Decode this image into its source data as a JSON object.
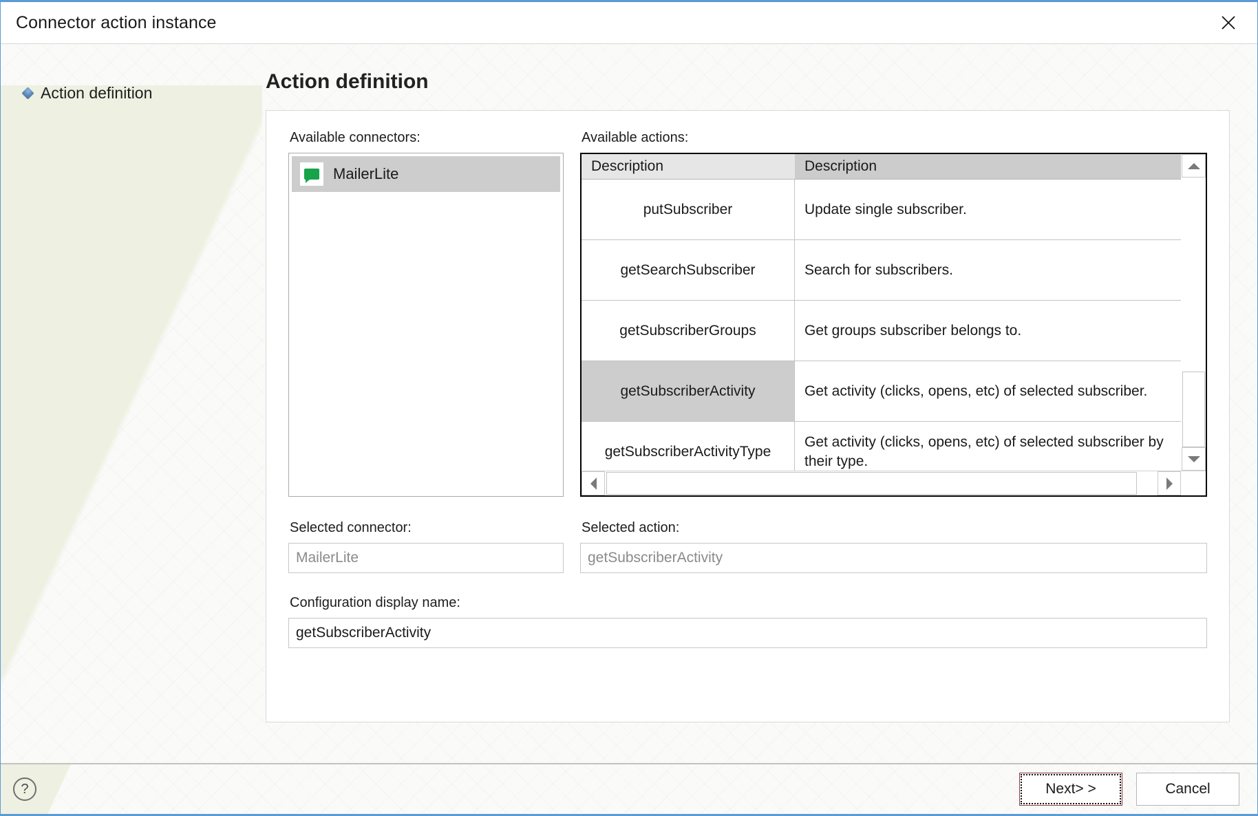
{
  "window": {
    "title": "Connector action instance",
    "close_icon": "close-icon"
  },
  "sidebar": {
    "items": [
      {
        "label": "Action definition",
        "bullet": "diamond-bullet-icon"
      }
    ]
  },
  "main": {
    "page_title": "Action definition",
    "connectors": {
      "label": "Available connectors:",
      "items": [
        {
          "label": "MailerLite",
          "icon": "green-flag-icon",
          "selected": true
        }
      ]
    },
    "actions": {
      "label": "Available actions:",
      "columns": [
        "Description",
        "Description"
      ],
      "rows": [
        {
          "name": "putSubscriber",
          "description": "Update single subscriber.",
          "selected": false
        },
        {
          "name": "getSearchSubscriber",
          "description": "Search for subscribers.",
          "selected": false
        },
        {
          "name": "getSubscriberGroups",
          "description": "Get groups subscriber belongs to.",
          "selected": false
        },
        {
          "name": "getSubscriberActivity",
          "description": "Get activity (clicks, opens, etc) of selected subscriber.",
          "selected": true
        },
        {
          "name": "getSubscriberActivityType",
          "description": "Get activity (clicks, opens, etc) of selected subscriber by their type.",
          "selected": false
        }
      ]
    },
    "selected_connector": {
      "label": "Selected connector:",
      "value": "MailerLite"
    },
    "selected_action": {
      "label": "Selected action:",
      "value": "getSubscriberActivity"
    },
    "display_name": {
      "label": "Configuration display name:",
      "value": "getSubscriberActivity"
    }
  },
  "footer": {
    "help_label": "?",
    "next_label": "Next> >",
    "cancel_label": "Cancel"
  },
  "colors": {
    "accent_border": "#5b9bd5",
    "connector_icon": "#16a34a",
    "selection": "#cdcdcd",
    "header_primary": "#e6e6e6",
    "header_secondary": "#cccccc"
  }
}
